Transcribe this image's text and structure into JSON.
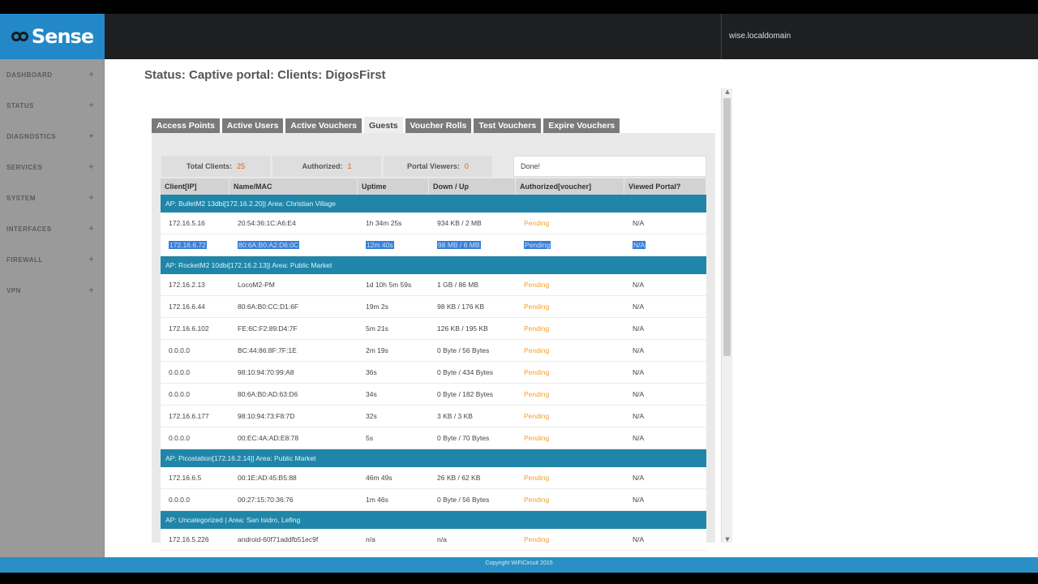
{
  "header": {
    "logo_text": "Sense",
    "hostname": "wise.localdomain"
  },
  "sidebar": {
    "items": [
      {
        "label": "DASHBOARD",
        "expand": "+"
      },
      {
        "label": "STATUS",
        "expand": "+"
      },
      {
        "label": "DIAGNOSTICS",
        "expand": "+"
      },
      {
        "label": "SERVICES",
        "expand": "+"
      },
      {
        "label": "SYSTEM",
        "expand": "+"
      },
      {
        "label": "INTERFACES",
        "expand": "+"
      },
      {
        "label": "FIREWALL",
        "expand": "+"
      },
      {
        "label": "VPN",
        "expand": "+"
      }
    ]
  },
  "page": {
    "title": "Status: Captive portal: Clients: DigosFirst"
  },
  "tabs": [
    {
      "label": "Access Points",
      "active": false
    },
    {
      "label": "Active Users",
      "active": false
    },
    {
      "label": "Active Vouchers",
      "active": false
    },
    {
      "label": "Guests",
      "active": true
    },
    {
      "label": "Voucher Rolls",
      "active": false
    },
    {
      "label": "Test Vouchers",
      "active": false
    },
    {
      "label": "Expire Vouchers",
      "active": false
    }
  ],
  "counters": {
    "total_label": "Total Clients:",
    "total_value": "25",
    "authorized_label": "Authorized:",
    "authorized_value": "1",
    "viewers_label": "Portal Viewers:",
    "viewers_value": "0"
  },
  "status_text": "Done!",
  "table": {
    "headers": [
      "Client[IP]",
      "Name/MAC",
      "Uptime",
      "Down / Up",
      "Authorized[voucher]",
      "Viewed Portal?"
    ],
    "groups": [
      {
        "ap": "AP: BulletM2 13dbi[172.16.2.20]| Area: Christian Village",
        "rows": [
          {
            "ip": "172.16.5.16",
            "mac": "20:54:36:1C:A6:E4",
            "uptime": "1h 34m 25s",
            "traffic": "934 KB / 2 MB",
            "auth": "Pending",
            "viewed": "N/A",
            "selected": false
          },
          {
            "ip": "172.16.6.72",
            "mac": "80:6A:B0:A2:D6:0C",
            "uptime": "12m 40s",
            "traffic": "98 MB / 6 MB",
            "auth": "Pending",
            "viewed": "N/A",
            "selected": true
          }
        ]
      },
      {
        "ap": "AP: RocketM2 10dbi[172.16.2.13]| Area: Public Market",
        "rows": [
          {
            "ip": "172.16.2.13",
            "mac": "LocoM2-PM",
            "uptime": "1d 10h 5m 59s",
            "traffic": "1 GB / 86 MB",
            "auth": "Pending",
            "viewed": "N/A",
            "selected": false
          },
          {
            "ip": "172.16.6.44",
            "mac": "80:6A:B0:CC:D1:6F",
            "uptime": "19m 2s",
            "traffic": "98 KB / 176 KB",
            "auth": "Pending",
            "viewed": "N/A",
            "selected": false
          },
          {
            "ip": "172.16.6.102",
            "mac": "FE:6C:F2:89:D4:7F",
            "uptime": "5m 21s",
            "traffic": "126 KB / 195 KB",
            "auth": "Pending",
            "viewed": "N/A",
            "selected": false
          },
          {
            "ip": "0.0.0.0",
            "mac": "BC:44:86:8F:7F:1E",
            "uptime": "2m 19s",
            "traffic": "0 Byte / 56 Bytes",
            "auth": "Pending",
            "viewed": "N/A",
            "selected": false
          },
          {
            "ip": "0.0.0.0",
            "mac": "98:10:94:70:99:A8",
            "uptime": "36s",
            "traffic": "0 Byte / 434 Bytes",
            "auth": "Pending",
            "viewed": "N/A",
            "selected": false
          },
          {
            "ip": "0.0.0.0",
            "mac": "80:6A:B0:AD:63:D6",
            "uptime": "34s",
            "traffic": "0 Byte / 182 Bytes",
            "auth": "Pending",
            "viewed": "N/A",
            "selected": false
          },
          {
            "ip": "172.16.6.177",
            "mac": "98:10:94:73:F8:7D",
            "uptime": "32s",
            "traffic": "3 KB / 3 KB",
            "auth": "Pending",
            "viewed": "N/A",
            "selected": false
          },
          {
            "ip": "0.0.0.0",
            "mac": "00:EC:4A:AD:E8:78",
            "uptime": "5s",
            "traffic": "0 Byte / 70 Bytes",
            "auth": "Pending",
            "viewed": "N/A",
            "selected": false
          }
        ]
      },
      {
        "ap": "AP: Picostation[172.16.2.14]| Area: Public Market",
        "rows": [
          {
            "ip": "172.16.6.5",
            "mac": "00:1E:AD:45:B5:88",
            "uptime": "46m 49s",
            "traffic": "26 KB / 62 KB",
            "auth": "Pending",
            "viewed": "N/A",
            "selected": false
          },
          {
            "ip": "0.0.0.0",
            "mac": "00:27:15:70:36:76",
            "uptime": "1m 46s",
            "traffic": "0 Byte / 56 Bytes",
            "auth": "Pending",
            "viewed": "N/A",
            "selected": false
          }
        ]
      },
      {
        "ap": "AP: Uncategorized | Area: San Isidro, Lefing",
        "rows": [
          {
            "ip": "172.16.5.226",
            "mac": "android-60f71addfb51ec9f",
            "uptime": "n/a",
            "traffic": "n/a",
            "auth": "Pending",
            "viewed": "N/A",
            "selected": false
          }
        ]
      }
    ]
  },
  "footer": {
    "text": "Copyright WiFiCircuit 2015"
  },
  "colors": {
    "brand_blue": "#2288c8",
    "ap_row": "#1f86a9",
    "pending": "#f0a030",
    "counter_value": "#e05a1a"
  }
}
